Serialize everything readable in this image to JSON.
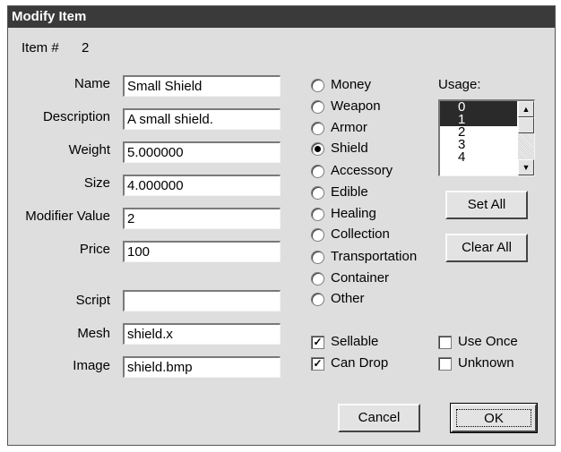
{
  "dialog": {
    "title": "Modify Item"
  },
  "item_number": {
    "label": "Item #",
    "value": "2"
  },
  "fields": {
    "name": {
      "label": "Name",
      "value": "Small Shield"
    },
    "description": {
      "label": "Description",
      "value": "A small shield."
    },
    "weight": {
      "label": "Weight",
      "value": "5.000000"
    },
    "size": {
      "label": "Size",
      "value": "4.000000"
    },
    "modifier_value": {
      "label": "Modifier Value",
      "value": "2"
    },
    "price": {
      "label": "Price",
      "value": "100"
    },
    "script": {
      "label": "Script",
      "value": ""
    },
    "mesh": {
      "label": "Mesh",
      "value": "shield.x"
    },
    "image": {
      "label": "Image",
      "value": "shield.bmp"
    }
  },
  "item_types": [
    {
      "label": "Money",
      "selected": false
    },
    {
      "label": "Weapon",
      "selected": false
    },
    {
      "label": "Armor",
      "selected": false
    },
    {
      "label": "Shield",
      "selected": true
    },
    {
      "label": "Accessory",
      "selected": false
    },
    {
      "label": "Edible",
      "selected": false
    },
    {
      "label": "Healing",
      "selected": false
    },
    {
      "label": "Collection",
      "selected": false
    },
    {
      "label": "Transportation",
      "selected": false
    },
    {
      "label": "Container",
      "selected": false
    },
    {
      "label": "Other",
      "selected": false
    }
  ],
  "usage": {
    "label": "Usage:",
    "items": [
      "0",
      "1",
      "2",
      "3",
      "4"
    ],
    "selected": [
      "0",
      "1"
    ],
    "set_all": "Set All",
    "clear_all": "Clear All"
  },
  "flags": {
    "sellable": {
      "label": "Sellable",
      "checked": true
    },
    "can_drop": {
      "label": "Can Drop",
      "checked": true
    },
    "use_once": {
      "label": "Use Once",
      "checked": false
    },
    "unknown": {
      "label": "Unknown",
      "checked": false
    }
  },
  "buttons": {
    "cancel": "Cancel",
    "ok": "OK"
  }
}
